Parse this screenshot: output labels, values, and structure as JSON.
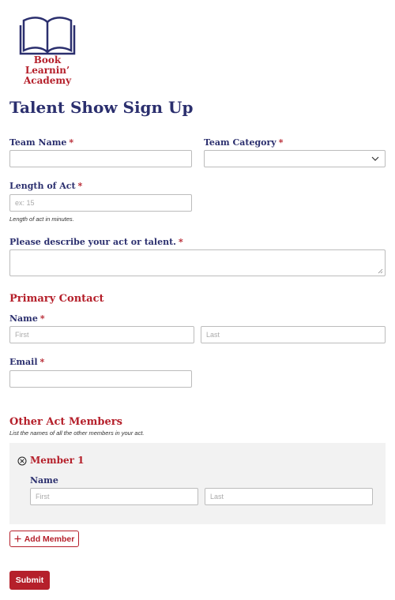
{
  "logo": {
    "line1": "Book Learnin’",
    "line2": "Academy"
  },
  "form": {
    "title": "Talent Show Sign Up",
    "required_mark": "*",
    "team_name": {
      "label": "Team Name",
      "value": ""
    },
    "team_category": {
      "label": "Team Category",
      "selected": ""
    },
    "length_of_act": {
      "label": "Length of Act",
      "placeholder": "ex: 15",
      "hint": "Length of act in minutes."
    },
    "describe": {
      "label": "Please describe your act or talent.",
      "value": ""
    },
    "primary_contact": {
      "heading": "Primary Contact",
      "name_label": "Name",
      "first_placeholder": "First",
      "last_placeholder": "Last",
      "email_label": "Email"
    },
    "other_members": {
      "heading": "Other Act Members",
      "hint": "List the names of all the other members in your act.",
      "member": {
        "title": "Member 1",
        "name_label": "Name",
        "first_placeholder": "First",
        "last_placeholder": "Last"
      },
      "add_button": "Add Member"
    },
    "submit": "Submit"
  },
  "colors": {
    "navy": "#2b2f6e",
    "red": "#b5202b",
    "panel": "#f2f2f2"
  },
  "icons": {
    "logo": "open-book-icon",
    "select": "chevron-down-icon",
    "remove": "circle-x-icon",
    "add": "plus-icon"
  }
}
